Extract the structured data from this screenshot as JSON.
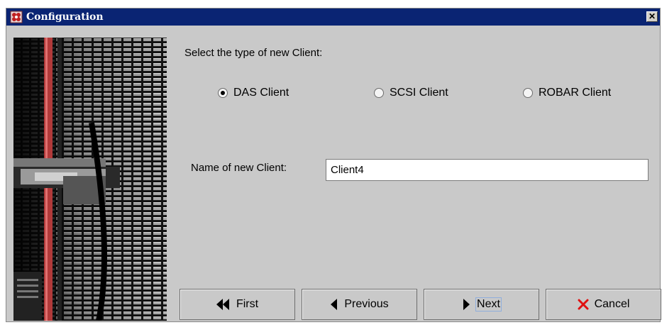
{
  "window": {
    "title": "Configuration",
    "title_bar_color": "#0a2473",
    "icon": "app-flower-icon",
    "close_symbol": "✕"
  },
  "prompt": "Select the type of new Client:",
  "client_types": [
    {
      "label": "DAS Client",
      "selected": true
    },
    {
      "label": "SCSI Client",
      "selected": false
    },
    {
      "label": "ROBAR Client",
      "selected": false
    }
  ],
  "name_field": {
    "label": "Name of new Client:",
    "value": "Client4"
  },
  "buttons": {
    "first": {
      "label": "First",
      "icon": "double-triangle-left-icon"
    },
    "previous": {
      "label": "Previous",
      "icon": "triangle-left-icon"
    },
    "next": {
      "label": "Next",
      "icon": "triangle-right-icon"
    },
    "cancel": {
      "label": "Cancel",
      "icon": "red-x-icon",
      "icon_color": "#e01010"
    }
  },
  "side_image": "tape-library-photo"
}
